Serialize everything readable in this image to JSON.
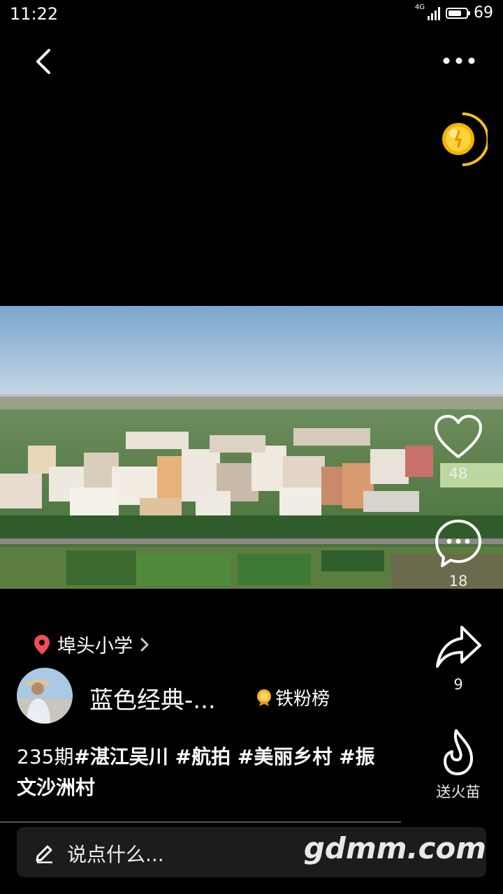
{
  "status_bar": {
    "time": "11:22",
    "network": "4G",
    "battery": "69"
  },
  "post": {
    "location": "埠头小学",
    "author": "蓝色经典-...",
    "fans_label": "铁粉榜",
    "caption_prefix": "235期",
    "caption_tags": "#湛江吴川 #航拍 #美丽乡村 #振文沙洲村"
  },
  "actions": {
    "like_count": "48",
    "comment_count": "18",
    "share_count": "9",
    "fire_label": "送火苗"
  },
  "comment_bar": {
    "placeholder": "说点什么..."
  },
  "watermark": "gdmm.com"
}
